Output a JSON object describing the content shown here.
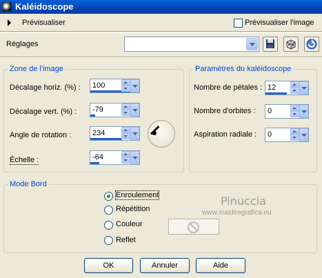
{
  "window": {
    "title": "Kaléidoscope",
    "title_icon": "kaleidoscope-icon"
  },
  "preview": {
    "label": "Prévisualiser",
    "checkbox_label": "Prévisualiser l'image",
    "checked": false
  },
  "settings": {
    "label": "Réglages",
    "value": "",
    "icons": [
      "save-icon",
      "dice-icon",
      "reset-icon"
    ]
  },
  "image_zone": {
    "title": "Zone de l'image",
    "fields": [
      {
        "label": "Décalage horiz. (%) :",
        "value": "100"
      },
      {
        "label": "Décalage vert. (%) :",
        "value": "-79"
      },
      {
        "label": "Angle de rotation :",
        "value": "234"
      },
      {
        "label": "Échelle :",
        "value": "-64"
      }
    ]
  },
  "kaleido": {
    "title": "Paramètres du kaléidoscope",
    "fields": [
      {
        "label": "Nombre de pétales :",
        "value": "12"
      },
      {
        "label": "Nombre d'orbites :",
        "value": "0"
      },
      {
        "label": "Aspiration radiale :",
        "value": "0"
      }
    ]
  },
  "edge_mode": {
    "title": "Mode Bord",
    "options": [
      "Enroulement",
      "Répétition",
      "Couleur",
      "Reflet"
    ],
    "selected": "Enroulement"
  },
  "watermark": {
    "name": "Pinuccia",
    "url": "www.maidiregrafica.eu"
  },
  "buttons": {
    "ok": "OK",
    "cancel": "Annuler",
    "help": "Aide"
  }
}
